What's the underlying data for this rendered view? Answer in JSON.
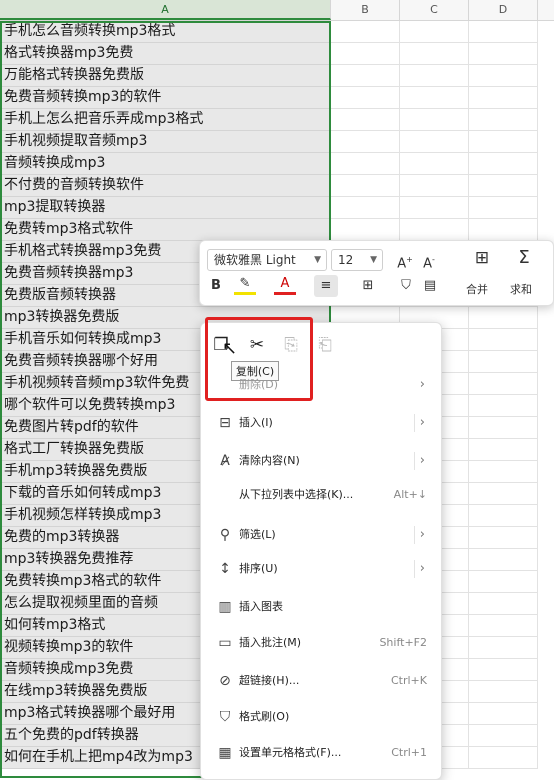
{
  "columns": [
    "A",
    "B",
    "C",
    "D"
  ],
  "rows": [
    "手机怎么音频转换mp3格式",
    "格式转换器mp3免费",
    "万能格式转换器免费版",
    "免费音频转换mp3的软件",
    "手机上怎么把音乐弄成mp3格式",
    "手机视频提取音频mp3",
    "音频转换成mp3",
    "不付费的音频转换软件",
    "mp3提取转换器",
    "免费转mp3格式软件",
    "手机格式转换器mp3免费",
    "免费音频转换器mp3",
    "免费版音频转换器",
    "mp3转换器免费版",
    "手机音乐如何转换成mp3",
    "免费音频转换器哪个好用",
    "手机视频转音频mp3软件免费",
    "哪个软件可以免费转换mp3",
    "免费图片转pdf的软件",
    "格式工厂转换器免费版",
    "手机mp3转换器免费版",
    "下载的音乐如何转成mp3",
    "手机视频怎样转换成mp3",
    "免费的mp3转换器",
    "mp3转换器免费推荐",
    "免费转换mp3格式的软件",
    "怎么提取视频里面的音频",
    "如何转mp3格式",
    "视频转换mp3的软件",
    "音频转换成mp3免费",
    "在线mp3转换器免费版",
    "mp3格式转换器哪个最好用",
    "五个免费的pdf转换器",
    "如何在手机上把mp4改为mp3"
  ],
  "mini_toolbar": {
    "font": "微软雅黑 Light",
    "size": "12",
    "merge_label": "合并",
    "sum_label": "求和",
    "bold": "B",
    "font_color_glyph": "A"
  },
  "context_menu": {
    "tooltip": "复制(C)",
    "partial_item": "删除(D)",
    "items": [
      {
        "label": "插入(I)",
        "shortcut": "",
        "arrow": "›"
      },
      {
        "label": "清除内容(N)",
        "shortcut": "",
        "arrow": "›"
      },
      {
        "label": "从下拉列表中选择(K)...",
        "shortcut": "Alt+↓",
        "arrow": ""
      },
      {
        "label": "筛选(L)",
        "shortcut": "",
        "arrow": "›"
      },
      {
        "label": "排序(U)",
        "shortcut": "",
        "arrow": "›"
      },
      {
        "label": "插入图表",
        "shortcut": "",
        "arrow": ""
      },
      {
        "label": "插入批注(M)",
        "shortcut": "Shift+F2",
        "arrow": ""
      },
      {
        "label": "超链接(H)...",
        "shortcut": "Ctrl+K",
        "arrow": ""
      },
      {
        "label": "格式刷(O)",
        "shortcut": "",
        "arrow": ""
      },
      {
        "label": "设置单元格格式(F)...",
        "shortcut": "Ctrl+1",
        "arrow": ""
      }
    ]
  },
  "colors": {
    "selection": "#2e8b3d",
    "highlight": "#e02020",
    "cell_fill": "#e8e8e8"
  }
}
